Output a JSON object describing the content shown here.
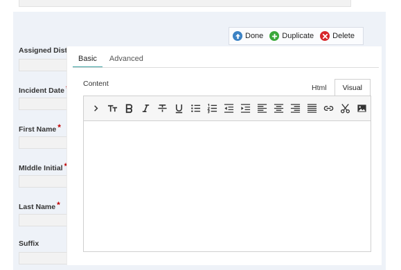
{
  "form": {
    "fields": [
      {
        "label": "Assigned Dist",
        "required": false
      },
      {
        "label": "Incident Date",
        "required": true
      },
      {
        "label": "First Name",
        "required": true
      },
      {
        "label": "MIddle Initial",
        "required": true
      },
      {
        "label": "Last Name",
        "required": true
      },
      {
        "label": "Suffix",
        "required": false
      }
    ],
    "required_marker": "*"
  },
  "actions": {
    "done": "Done",
    "duplicate": "Duplicate",
    "delete": "Delete"
  },
  "tabs": {
    "basic": "Basic",
    "advanced": "Advanced",
    "active": "Basic"
  },
  "content": {
    "label": "Content",
    "modes": {
      "html": "Html",
      "visual": "Visual"
    },
    "active_mode": "Visual",
    "value": ""
  },
  "toolbar": {
    "buttons": [
      "chevron-right",
      "text-size",
      "bold",
      "italic",
      "strikethrough",
      "underline",
      "bullet-list",
      "numbered-list",
      "outdent",
      "indent",
      "align-left",
      "align-center",
      "align-right",
      "justify",
      "link",
      "cut",
      "image"
    ]
  },
  "colors": {
    "panel_bg": "#eef2f8",
    "accent": "#3aa0a0",
    "required": "#c00000",
    "done": "#3b82c4",
    "duplicate": "#3aa83a",
    "delete": "#d7262a"
  }
}
